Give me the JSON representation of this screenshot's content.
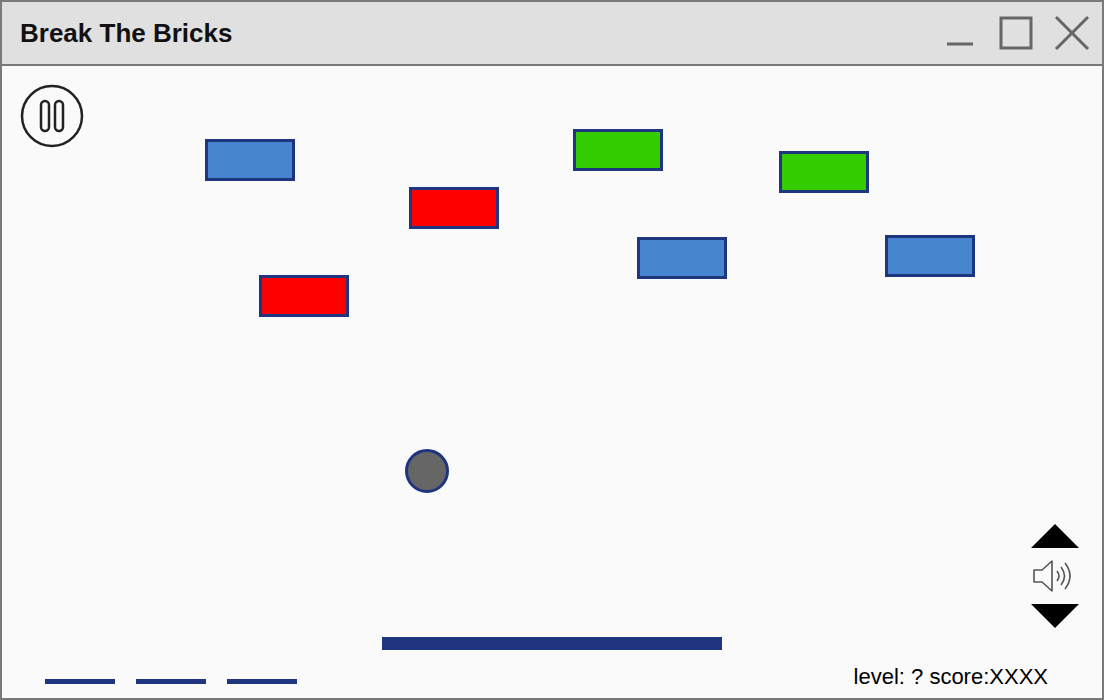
{
  "window": {
    "title": "Break The Bricks"
  },
  "bricks": [
    {
      "color": "#4686cf"
    },
    {
      "color": "#ff0000"
    },
    {
      "color": "#33cc00"
    },
    {
      "color": "#33cc00"
    },
    {
      "color": "#4686cf"
    },
    {
      "color": "#4686cf"
    },
    {
      "color": "#ff0000"
    }
  ],
  "lives_remaining": 3,
  "sound": {
    "muted": false
  },
  "status": "level: ? score:XXXX"
}
